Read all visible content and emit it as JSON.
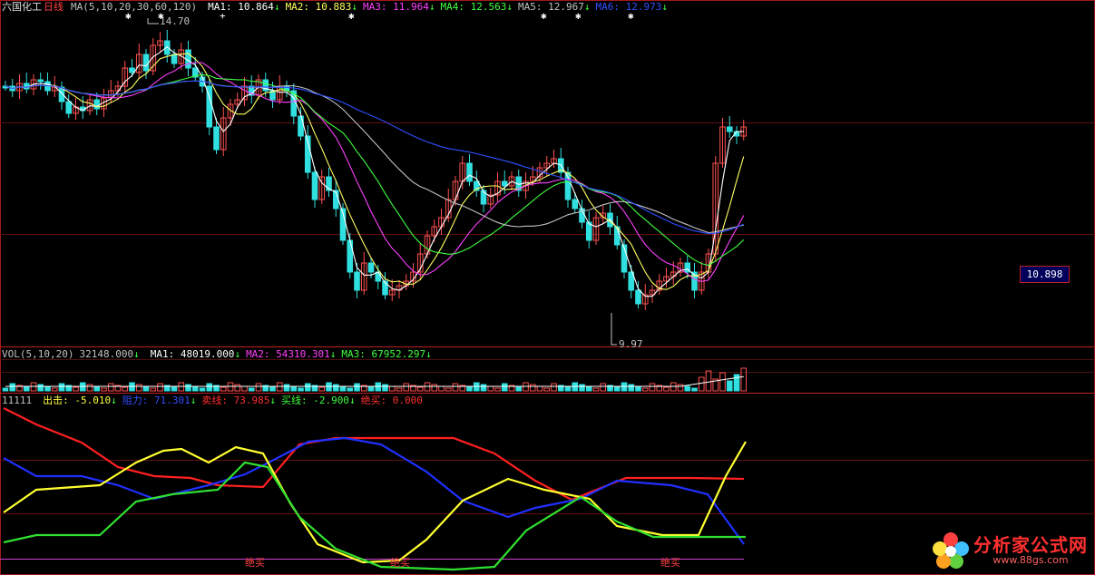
{
  "main": {
    "title": "六国化工",
    "period": "日线",
    "ma_params": "MA(5,10,20,30,60,120)",
    "ma": [
      {
        "label": "MA1:",
        "value": "10.864",
        "arrow": "↓",
        "color": "#ffffff"
      },
      {
        "label": "MA2:",
        "value": "10.883",
        "arrow": "↓",
        "color": "#ffff60"
      },
      {
        "label": "MA3:",
        "value": "11.964",
        "arrow": "↓",
        "color": "#ff40ff"
      },
      {
        "label": "MA4:",
        "value": "12.563",
        "arrow": "↓",
        "color": "#40ff40"
      },
      {
        "label": "MA5:",
        "value": "12.967",
        "arrow": "↓",
        "color": "#c0c0c0"
      },
      {
        "label": "MA6:",
        "value": "12.973",
        "arrow": "↓",
        "color": "#3050ff"
      }
    ],
    "high_label": "14.70",
    "low_label": "9.97",
    "current_price": "10.898"
  },
  "volume": {
    "params": "VOL(5,10,20)",
    "value": "32148.000",
    "arrow": "↓",
    "ma": [
      {
        "label": "MA1:",
        "value": "48019.000",
        "arrow": "↓",
        "color": "#ffffff"
      },
      {
        "label": "MA2:",
        "value": "54310.301",
        "arrow": "↓",
        "color": "#ff40ff"
      },
      {
        "label": "MA3:",
        "value": "67952.297",
        "arrow": "↓",
        "color": "#40ff40"
      }
    ]
  },
  "indicator": {
    "name": "11111",
    "fields": [
      {
        "label": "出击:",
        "value": "-5.010",
        "arrow": "↓",
        "color": "#ffff40"
      },
      {
        "label": "阻力:",
        "value": "71.301",
        "arrow": "↓",
        "color": "#3050ff"
      },
      {
        "label": "卖线:",
        "value": "73.985",
        "arrow": "↓",
        "color": "#ff3030"
      },
      {
        "label": "买线:",
        "value": "-2.900",
        "arrow": "↓",
        "color": "#40ff40"
      },
      {
        "label": "绝买:",
        "value": "0.000",
        "arrow": "",
        "color": "#ff3030"
      }
    ],
    "signal_label": "绝买"
  },
  "logo": {
    "name": "分析家公式网",
    "url": "www.88gs.com"
  }
}
